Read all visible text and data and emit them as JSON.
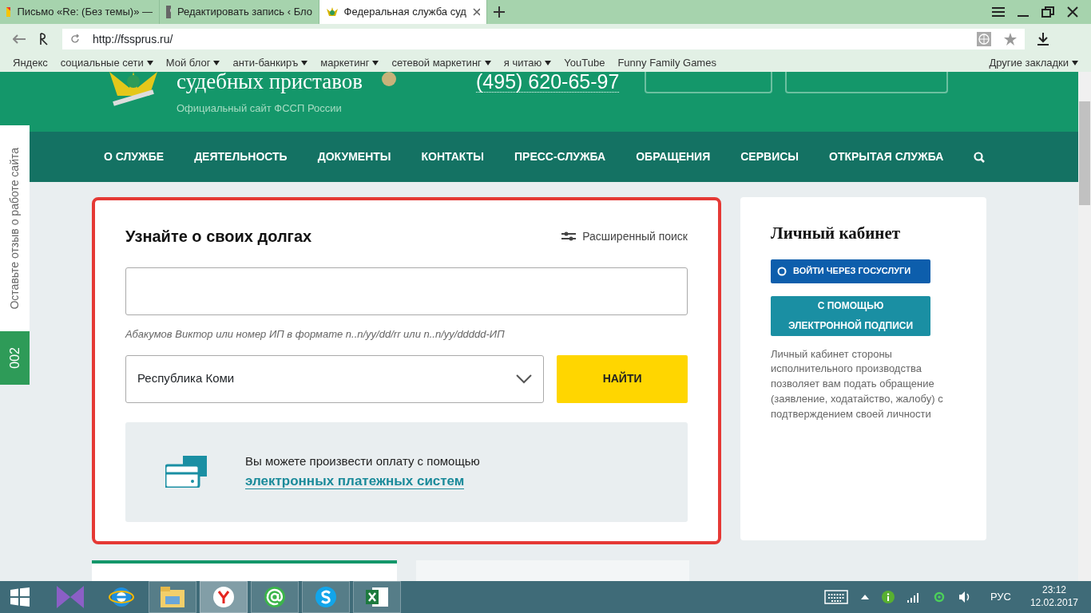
{
  "browser": {
    "tabs": [
      {
        "title": "Письмо «Re: (Без темы)» —",
        "kind": "mail",
        "selected": false
      },
      {
        "title": "Редактировать запись ‹ Бло",
        "kind": "photo",
        "selected": false
      },
      {
        "title": "Федеральная служба суд",
        "kind": "emblem",
        "selected": true
      }
    ],
    "address": "http://fssprus.ru/",
    "bookmarks": [
      {
        "label": "Яндекс",
        "dropdown": false
      },
      {
        "label": "социальные сети",
        "dropdown": true
      },
      {
        "label": "Мой блог",
        "dropdown": true
      },
      {
        "label": "анти-банкиръ",
        "dropdown": true
      },
      {
        "label": "маркетинг",
        "dropdown": true
      },
      {
        "label": "сетевой маркетинг",
        "dropdown": true
      },
      {
        "label": "я читаю",
        "dropdown": true
      },
      {
        "label": "YouTube",
        "dropdown": false
      },
      {
        "label": "Funny Family Games",
        "dropdown": false
      }
    ],
    "other_bookmarks": "Другие закладки"
  },
  "header": {
    "title": "судебных приставов",
    "subtitle": "Официальный сайт ФССП России",
    "phone": "(495) 620-65-97"
  },
  "nav": {
    "items": [
      "О СЛУЖБЕ",
      "ДЕЯТЕЛЬНОСТЬ",
      "ДОКУМЕНТЫ",
      "КОНТАКТЫ",
      "ПРЕСС-СЛУЖБА",
      "ОБРАЩЕНИЯ",
      "СЕРВИСЫ",
      "ОТКРЫТАЯ СЛУЖБА"
    ]
  },
  "feedback": {
    "label": "Оставьте отзыв о работе сайта",
    "counter": "002"
  },
  "debt_search": {
    "title": "Узнайте о своих долгах",
    "advanced": "Расширенный поиск",
    "hint": "Абакумов Виктор или номер ИП в формате n..n/yy/dd/rr или n..n/yy/ddddd-ИП",
    "region": "Республика Коми",
    "find_button": "НАЙТИ",
    "payment_text": "Вы можете произвести оплату с помощью",
    "payment_link": "электронных платежных систем"
  },
  "cabinet": {
    "title": "Личный кабинет",
    "gosuslugi_button": "ВОЙТИ ЧЕРЕЗ ГОСУСЛУГИ",
    "signature_button": "С ПОМОЩЬЮ ЭЛЕКТРОННОЙ ПОДПИСИ",
    "description": "Личный кабинет стороны исполнительного производства позволяет вам подать обращение (заявление, ходатайство, жалобу) с подтверждением своей личности"
  },
  "taskbar": {
    "apps": [
      {
        "kind": "studio",
        "running": false,
        "selected": false
      },
      {
        "kind": "ie",
        "running": false,
        "selected": false
      },
      {
        "kind": "explorer",
        "running": true,
        "selected": false
      },
      {
        "kind": "yandex",
        "running": true,
        "selected": true
      },
      {
        "kind": "mailagent",
        "running": true,
        "selected": false
      },
      {
        "kind": "skype",
        "running": true,
        "selected": false
      },
      {
        "kind": "excel",
        "running": true,
        "selected": false
      }
    ],
    "language": "РУС",
    "time": "23:12",
    "date": "12.02.2017"
  }
}
